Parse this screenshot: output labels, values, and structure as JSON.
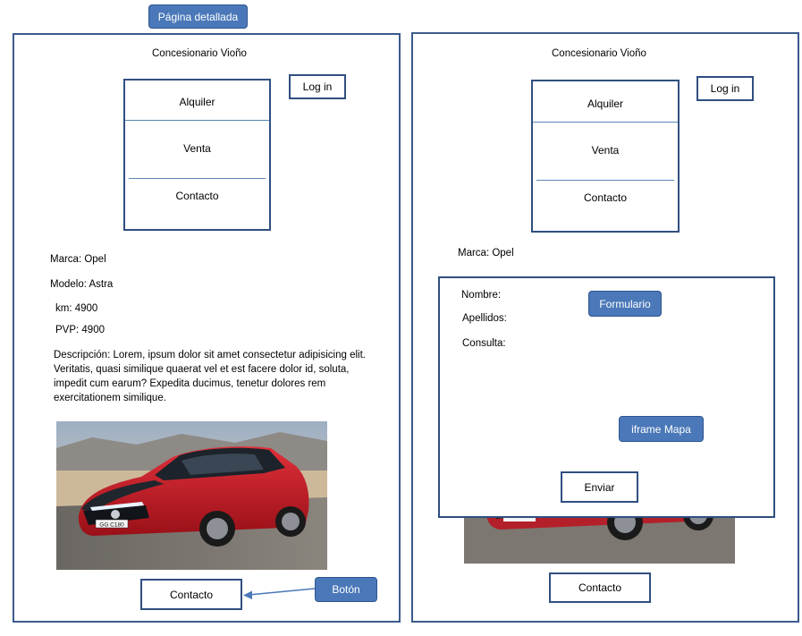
{
  "callouts": {
    "detail_page": "Página detallada",
    "button": "Botón",
    "form": "Formulario",
    "map": "iframe Mapa"
  },
  "left": {
    "title": "Concesionario Vioño",
    "login": "Log in",
    "menu": [
      "Alquiler",
      "Venta",
      "Contacto"
    ],
    "marca": "Marca: Opel",
    "modelo": "Modelo: Astra",
    "km": "km: 4900",
    "pvp": "PVP: 4900",
    "descripcion": "Descripción: Lorem, ipsum dolor sit amet consectetur adipisicing elit. Veritatis, quasi similique quaerat vel et est facere dolor id, soluta, impedit cum earum? Expedita ducimus, tenetur dolores rem exercitationem similique.",
    "plate": "GG C180",
    "contact_button": "Contacto"
  },
  "right": {
    "title": "Concesionario Vioño",
    "login": "Log in",
    "menu": [
      "Alquiler",
      "Venta",
      "Contacto"
    ],
    "marca": "Marca: Opel",
    "form": {
      "nombre": "Nombre:",
      "apellidos": "Apellidos:",
      "consulta": "Consulta:",
      "send": "Enviar"
    },
    "contact_button": "Contacto"
  }
}
